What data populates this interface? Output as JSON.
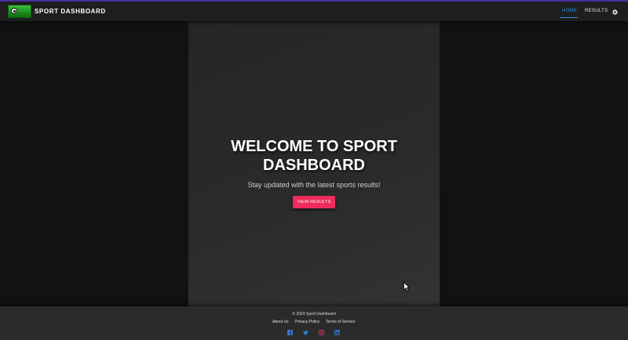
{
  "header": {
    "app_title": "SPORT DASHBOARD",
    "logo_icon": "soccer-field-logo",
    "nav": [
      {
        "label": "HOME",
        "active": true
      },
      {
        "label": "RESULTS",
        "active": false
      }
    ],
    "settings_icon": "gear-icon",
    "accent_color": "#2e8fe0"
  },
  "hero": {
    "title": "WELCOME TO SPORT DASHBOARD",
    "subtitle": "Stay updated with the latest sports results!",
    "button_label": "VIEW RESULTS",
    "button_color": "#ee2b5b"
  },
  "footer": {
    "copyright": "© 2024 Sport Dashboard",
    "links": [
      "About Us",
      "Privacy Policy",
      "Terms of Service"
    ],
    "social_icons": [
      "facebook-icon",
      "twitter-icon",
      "instagram-icon",
      "linkedin-icon"
    ]
  }
}
